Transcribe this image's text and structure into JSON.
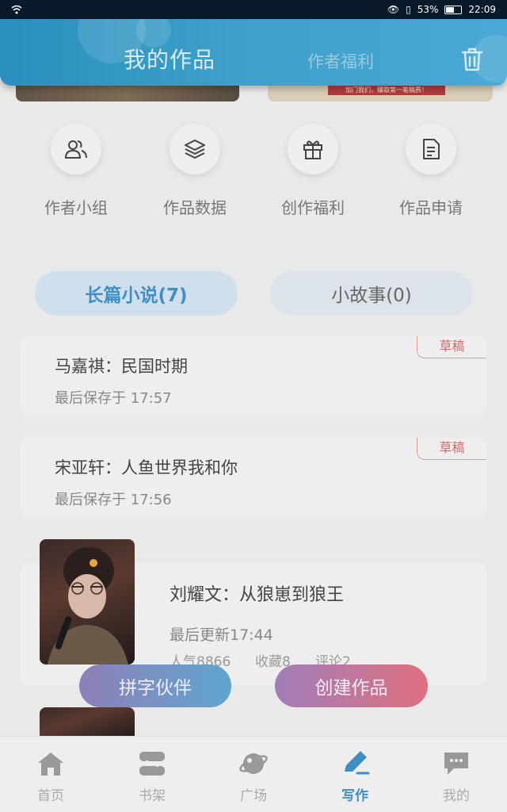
{
  "status_bar": {
    "battery": "53%",
    "time": "22:09"
  },
  "header": {
    "title": "我的作品",
    "tab_welfare": "作者福利"
  },
  "banner": {
    "right_strip_text": "加门我们，赚取第一笔稿费！"
  },
  "quick_actions": [
    {
      "label": "作者小组",
      "icon": "group-icon"
    },
    {
      "label": "作品数据",
      "icon": "layers-icon"
    },
    {
      "label": "创作福利",
      "icon": "gift-icon"
    },
    {
      "label": "作品申请",
      "icon": "document-icon"
    }
  ],
  "tabs": {
    "long_novel": "长篇小说(7)",
    "short_story": "小故事(0)"
  },
  "drafts": [
    {
      "title": "马嘉祺：民国时期",
      "saved": "最后保存于 17:57",
      "tag": "草稿"
    },
    {
      "title": "宋亚轩：人鱼世界我和你",
      "saved": "最后保存于 17:56",
      "tag": "草稿"
    }
  ],
  "published": {
    "title": "刘耀文：从狼崽到狼王",
    "updated": "最后更新17:44",
    "popularity": "人气8866",
    "favorites": "收藏8",
    "comments": "评论2"
  },
  "buttons": {
    "partner": "拼字伙伴",
    "create": "创建作品"
  },
  "nav": [
    {
      "label": "首页",
      "icon": "home-icon"
    },
    {
      "label": "书架",
      "icon": "bookshelf-icon"
    },
    {
      "label": "广场",
      "icon": "planet-icon"
    },
    {
      "label": "写作",
      "icon": "pen-icon"
    },
    {
      "label": "我的",
      "icon": "chat-icon"
    }
  ],
  "colors": {
    "accent": "#3e8fc4",
    "draft_tag": "#d46a6a",
    "header": "#3fa1cb"
  }
}
